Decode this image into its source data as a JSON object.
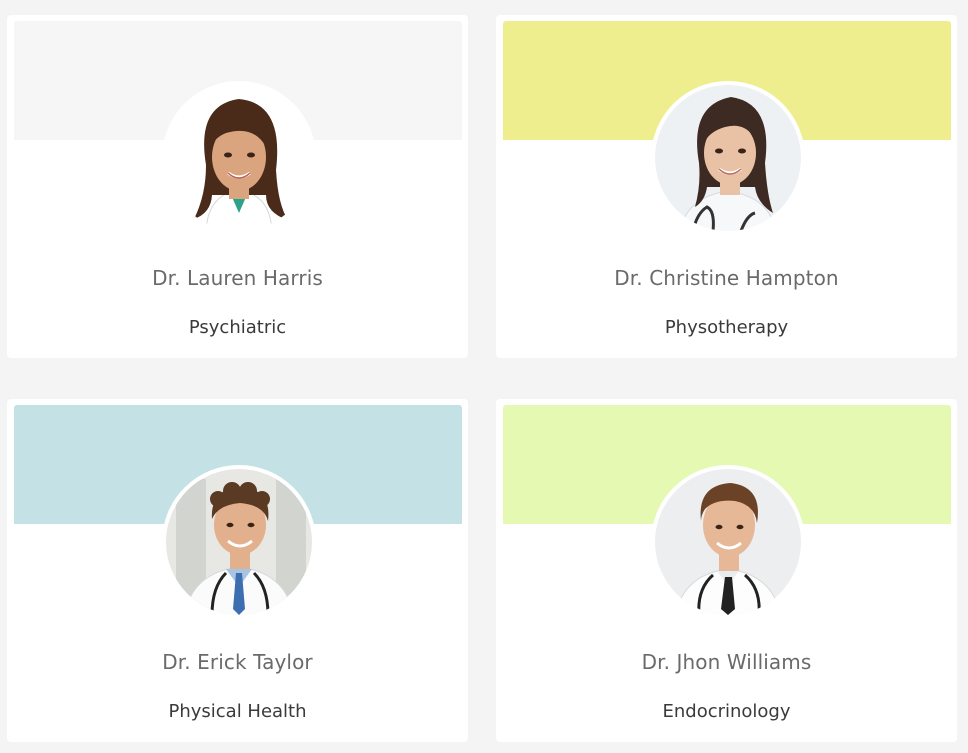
{
  "doctors": [
    {
      "name": "Dr. Lauren Harris",
      "specialty": "Psychiatric",
      "band_color": "#f6f6f6",
      "photo_icon": "female-doctor-portrait-icon"
    },
    {
      "name": "Dr. Christine Hampton",
      "specialty": "Physotherapy",
      "band_color": "#eeee8e",
      "photo_icon": "female-doctor-stethoscope-portrait-icon"
    },
    {
      "name": "Dr. Erick Taylor",
      "specialty": "Physical Health",
      "band_color": "#c4e1e5",
      "photo_icon": "male-doctor-curly-hair-portrait-icon"
    },
    {
      "name": "Dr. Jhon Williams",
      "specialty": "Endocrinology",
      "band_color": "#e5f9b3",
      "photo_icon": "male-doctor-stethoscope-portrait-icon"
    }
  ]
}
